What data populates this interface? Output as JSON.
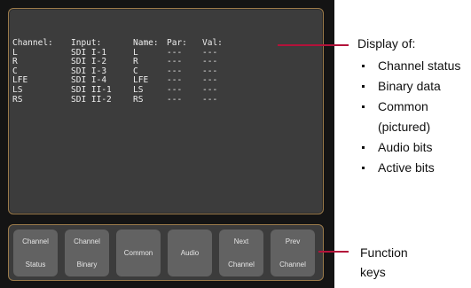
{
  "display": {
    "headers": [
      "Channel:",
      "Input:",
      "Name:",
      "Par:",
      "Val:"
    ],
    "rows": [
      [
        "L",
        "SDI I-1",
        "L",
        "---",
        "---"
      ],
      [
        "R",
        "SDI I-2",
        "R",
        "---",
        "---"
      ],
      [
        "C",
        "SDI I-3",
        "C",
        "---",
        "---"
      ],
      [
        "LFE",
        "SDI I-4",
        "LFE",
        "---",
        "---"
      ],
      [
        "LS",
        "SDI II-1",
        "LS",
        "---",
        "---"
      ],
      [
        "RS",
        "SDI II-2",
        "RS",
        "---",
        "---"
      ]
    ]
  },
  "function_keys": [
    {
      "lines": [
        "Channel",
        "Status"
      ]
    },
    {
      "lines": [
        "Channel",
        "Binary"
      ]
    },
    {
      "lines": [
        "Common"
      ]
    },
    {
      "lines": [
        "Audio"
      ]
    },
    {
      "lines": [
        "Next",
        "Channel"
      ]
    },
    {
      "lines": [
        "Prev",
        "Channel"
      ]
    }
  ],
  "annotations": {
    "display_title": "Display of:",
    "display_items": [
      "Channel status",
      "Binary data",
      "Common",
      "(pictured)",
      "Audio bits",
      "Active bits"
    ],
    "keys_label_line1": "Function",
    "keys_label_line2": "keys"
  },
  "colors": {
    "callout_line": "#b3123a",
    "panel_border": "#9a7a4a"
  }
}
